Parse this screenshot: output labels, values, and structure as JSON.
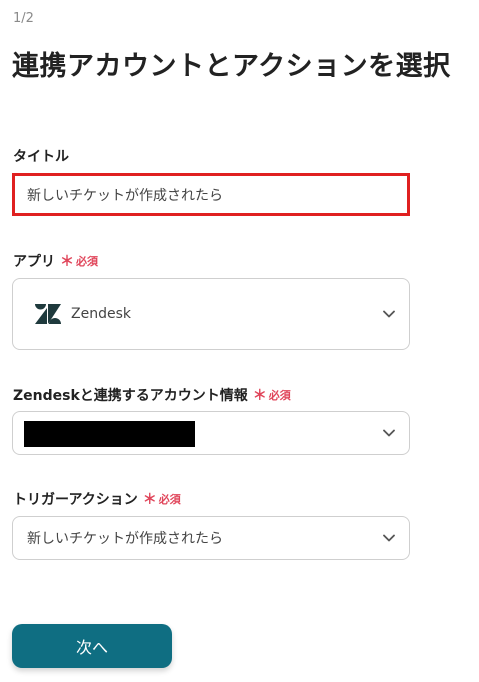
{
  "step_indicator": "1/2",
  "page_title": "連携アカウントとアクションを選択",
  "required_label": "必須",
  "title_field": {
    "label": "タイトル",
    "value": "新しいチケットが作成されたら"
  },
  "app_field": {
    "label": "アプリ",
    "selected_app": "Zendesk",
    "icon": "zendesk-logo-icon"
  },
  "account_field": {
    "label": "Zendeskと連携するアカウント情報",
    "value_redacted": true
  },
  "trigger_field": {
    "label": "トリガーアクション",
    "value": "新しいチケットが作成されたら"
  },
  "next_button": "次へ",
  "colors": {
    "primary_button": "#0f6e82",
    "required": "#e0455a",
    "highlight_border": "#e02020"
  }
}
